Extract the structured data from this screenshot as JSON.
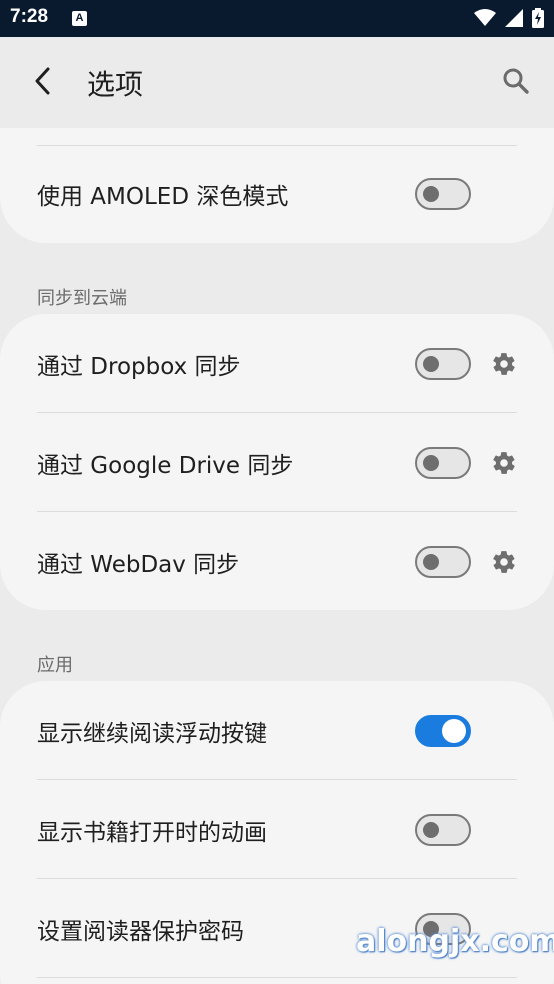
{
  "status_bar": {
    "time": "7:28",
    "notification_icon": "A",
    "icons": [
      "wifi-icon",
      "cell-signal-icon",
      "battery-charging-icon"
    ]
  },
  "app_bar": {
    "back_icon": "back-arrow-icon",
    "title": "选项",
    "search_icon": "search-icon"
  },
  "display_section": {
    "rows": [
      {
        "label": "使用 AMOLED 深色模式",
        "enabled": false
      }
    ]
  },
  "sync_section": {
    "header": "同步到云端",
    "rows": [
      {
        "label": "通过 Dropbox 同步",
        "enabled": false,
        "settings_icon": "gear-icon"
      },
      {
        "label": "通过 Google Drive 同步",
        "enabled": false,
        "settings_icon": "gear-icon"
      },
      {
        "label": "通过 WebDav 同步",
        "enabled": false,
        "settings_icon": "gear-icon"
      }
    ]
  },
  "app_section": {
    "header": "应用",
    "rows": [
      {
        "label": "显示继续阅读浮动按键",
        "enabled": true
      },
      {
        "label": "显示书籍打开时的动画",
        "enabled": false
      },
      {
        "label": "设置阅读器保护密码",
        "enabled": false
      }
    ]
  },
  "watermark": "alongjx.com",
  "colors": {
    "accent": "#1b7ce0",
    "status_bar": "#0a1a2e",
    "background": "#ebebeb",
    "card": "#f5f5f5"
  }
}
